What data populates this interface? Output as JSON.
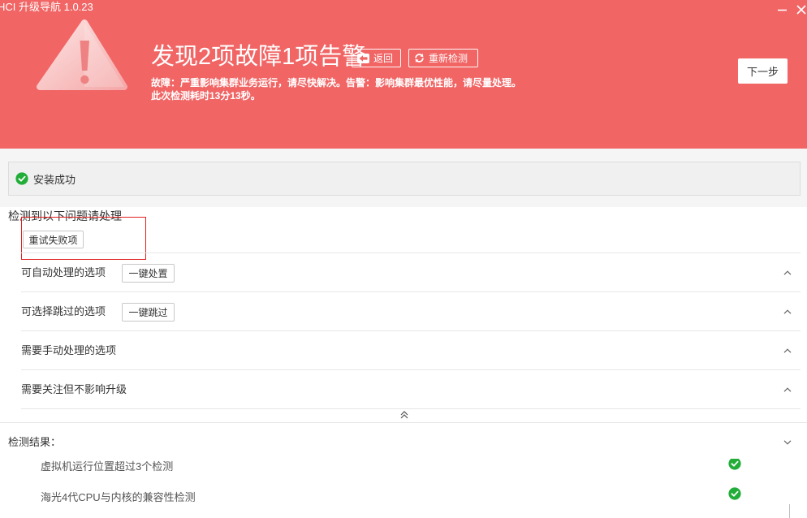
{
  "window": {
    "title": "HCI 升级导航 1.0.23"
  },
  "header": {
    "title": "发现2项故障1项告警",
    "back_label": "返回",
    "recheck_label": "重新检测",
    "description_line1": "故障：严重影响集群业务运行，请尽快解决。告警：影响集群最优性能，请尽量处理。",
    "description_line2": "此次检测耗时13分13秒。",
    "next_label": "下一步"
  },
  "install_status": {
    "label": "安装成功"
  },
  "issues": {
    "heading": "检测到以下问题请处理",
    "retry_label": "重试失败项",
    "groups": [
      {
        "label": "可自动处理的选项",
        "action": "一键处置"
      },
      {
        "label": "可选择跳过的选项",
        "action": "一键跳过"
      },
      {
        "label": "需要手动处理的选项"
      },
      {
        "label": "需要关注但不影响升级"
      }
    ]
  },
  "results": {
    "heading": "检测结果：",
    "items": [
      {
        "label": "虚拟机运行位置超过3个检测",
        "icon": "check-circle-icon"
      },
      {
        "label": "海光4代CPU与内核的兼容性检测",
        "icon": "check-circle-icon"
      }
    ]
  },
  "icons": {
    "minimize": "minimize-icon",
    "close": "close-icon",
    "warning": "warning-triangle-icon",
    "back": "arrow-left-icon",
    "recheck": "refresh-icon",
    "success": "check-circle-icon",
    "group_toggle": "chevron-up-icon",
    "collapse_all": "double-chevron-up-icon",
    "results_toggle": "chevron-down-icon"
  },
  "colors": {
    "header_bg": "#F16565",
    "success_green": "#22AC38",
    "highlight_red": "#E02020",
    "text": "#333333"
  }
}
